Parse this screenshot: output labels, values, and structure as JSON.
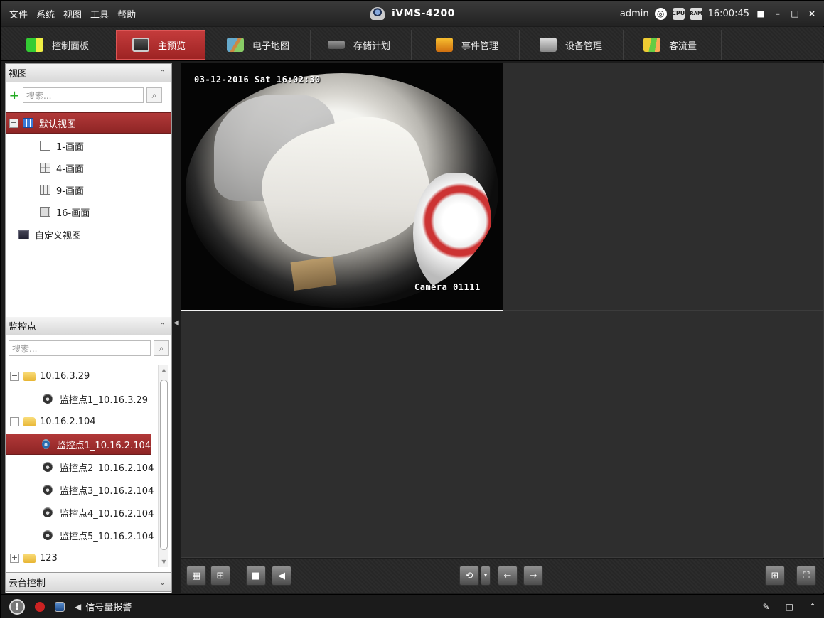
{
  "menu": [
    "文件",
    "系统",
    "视图",
    "工具",
    "帮助"
  ],
  "app_title": "iVMS-4200",
  "status": {
    "user": "admin",
    "time": "16:00:45",
    "cpu_icon_text": "CPU",
    "ram_icon_text": "RAM"
  },
  "tabs": [
    {
      "label": "控制面板",
      "icon": "dashboard-icon"
    },
    {
      "label": "主预览",
      "icon": "preview-icon",
      "active": true
    },
    {
      "label": "电子地图",
      "icon": "map-icon"
    },
    {
      "label": "存储计划",
      "icon": "recording-icon"
    },
    {
      "label": "事件管理",
      "icon": "event-icon"
    },
    {
      "label": "设备管理",
      "icon": "device-icon"
    },
    {
      "label": "客流量",
      "icon": "people-counting-icon"
    }
  ],
  "views_panel": {
    "title": "视图",
    "search_placeholder": "搜索...",
    "items": [
      {
        "label": "默认视图",
        "level": 0,
        "expanded": true,
        "selected": true,
        "icon": "default-view-icon"
      },
      {
        "label": "1-画面",
        "level": 1,
        "icon": "layout-1-icon"
      },
      {
        "label": "4-画面",
        "level": 1,
        "icon": "layout-4-icon"
      },
      {
        "label": "9-画面",
        "level": 1,
        "icon": "layout-9-icon"
      },
      {
        "label": "16-画面",
        "level": 1,
        "icon": "layout-16-icon"
      },
      {
        "label": "自定义视图",
        "level": 0,
        "icon": "custom-view-icon"
      }
    ]
  },
  "monitor_panel": {
    "title": "监控点",
    "search_placeholder": "搜索...",
    "items": [
      {
        "label": "10.16.3.29",
        "type": "folder",
        "expanded": true
      },
      {
        "label": "监控点1_10.16.3.29",
        "type": "camera"
      },
      {
        "label": "10.16.2.104",
        "type": "folder",
        "expanded": true
      },
      {
        "label": "监控点1_10.16.2.104",
        "type": "camera",
        "selected": true
      },
      {
        "label": "监控点2_10.16.2.104",
        "type": "camera"
      },
      {
        "label": "监控点3_10.16.2.104",
        "type": "camera"
      },
      {
        "label": "监控点4_10.16.2.104",
        "type": "camera"
      },
      {
        "label": "监控点5_10.16.2.104",
        "type": "camera"
      },
      {
        "label": "123",
        "type": "folder",
        "expanded": false
      }
    ]
  },
  "ptz_panel": {
    "title": "云台控制"
  },
  "video": {
    "osd_time": "03-12-2016 Sat 16:02:30",
    "osd_camera": "Camera 01111"
  },
  "statusbar": {
    "alarm_label": "信号量报警"
  },
  "colors": {
    "accent": "#a82d2d",
    "dark_bg": "#2b2b2b"
  }
}
